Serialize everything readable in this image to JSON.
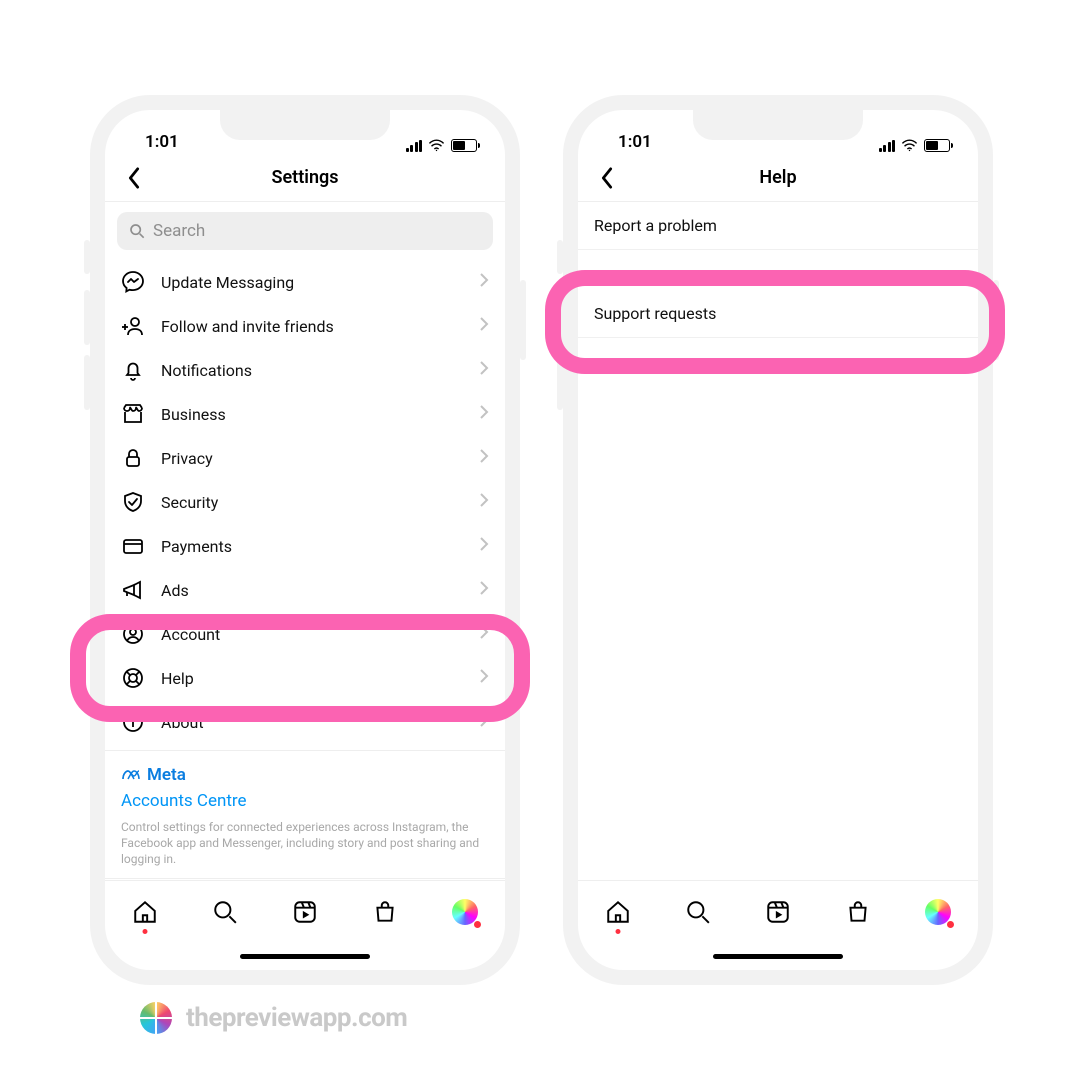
{
  "status": {
    "time": "1:01"
  },
  "settings": {
    "title": "Settings",
    "search_placeholder": "Search",
    "rows": [
      {
        "label": "Update Messaging"
      },
      {
        "label": "Follow and invite friends"
      },
      {
        "label": "Notifications"
      },
      {
        "label": "Business"
      },
      {
        "label": "Privacy"
      },
      {
        "label": "Security"
      },
      {
        "label": "Payments"
      },
      {
        "label": "Ads"
      },
      {
        "label": "Account"
      },
      {
        "label": "Help"
      },
      {
        "label": "About"
      }
    ],
    "meta": {
      "brand": "Meta",
      "accounts_centre": "Accounts Centre",
      "description": "Control settings for connected experiences across Instagram, the Facebook app and Messenger, including story and post sharing and logging in."
    }
  },
  "help": {
    "title": "Help",
    "rows": [
      {
        "label": "Report a problem"
      },
      {
        "label": "Support requests"
      }
    ]
  },
  "watermark": "thepreviewapp.com"
}
